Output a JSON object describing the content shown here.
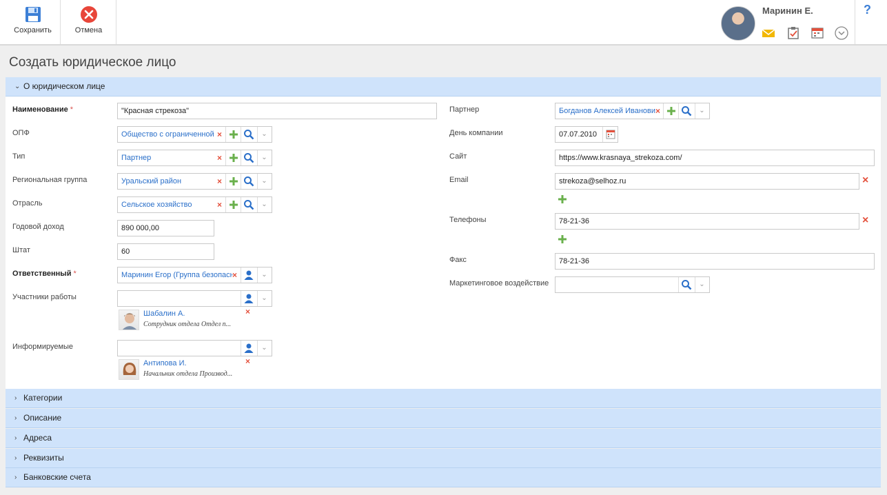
{
  "toolbar": {
    "save_label": "Сохранить",
    "cancel_label": "Отмена"
  },
  "user": {
    "name": "Маринин Е."
  },
  "help": {
    "label": "?"
  },
  "page": {
    "title": "Создать юридическое лицо"
  },
  "sections": {
    "about": "О юридическом лице",
    "categories": "Категории",
    "description": "Описание",
    "addresses": "Адреса",
    "requisites": "Реквизиты",
    "bank": "Банковские счета"
  },
  "form": {
    "name": {
      "label": "Наименование",
      "value": "\"Красная стрекоза\""
    },
    "opf": {
      "label": "ОПФ",
      "value": "Общество с ограниченной ответственностью"
    },
    "type": {
      "label": "Тип",
      "value": "Партнер"
    },
    "region": {
      "label": "Региональная группа",
      "value": "Уральский район"
    },
    "industry": {
      "label": "Отрасль",
      "value": "Сельское хозяйство"
    },
    "income": {
      "label": "Годовой доход",
      "value": "890 000,00"
    },
    "staff": {
      "label": "Штат",
      "value": "60"
    },
    "responsible": {
      "label": "Ответственный",
      "value": "Маринин Егор (Группа безопасности)"
    },
    "participants": {
      "label": "Участники работы",
      "person": {
        "name": "Шабалин А.",
        "role": "Сотрудник отдела Отдел п..."
      }
    },
    "informed": {
      "label": "Информируемые",
      "person": {
        "name": "Антипова И.",
        "role": "Начальник отдела Производ..."
      }
    },
    "partner": {
      "label": "Партнер",
      "value": "Богданов Алексей Иванович"
    },
    "company_day": {
      "label": "День компании",
      "value": "07.07.2010"
    },
    "site": {
      "label": "Сайт",
      "value": "https://www.krasnaya_strekoza.com/"
    },
    "email": {
      "label": "Email",
      "value": "strekoza@selhoz.ru"
    },
    "phones": {
      "label": "Телефоны",
      "value": "78-21-36"
    },
    "fax": {
      "label": "Факс",
      "value": "78-21-36"
    },
    "marketing": {
      "label": "Маркетинговое воздействие",
      "value": ""
    },
    "required_mark": "*"
  },
  "colors": {
    "accent": "#3c7fd6",
    "section_bg": "#cfe3fb",
    "delete": "#e4503c",
    "add": "#6ab04c"
  }
}
